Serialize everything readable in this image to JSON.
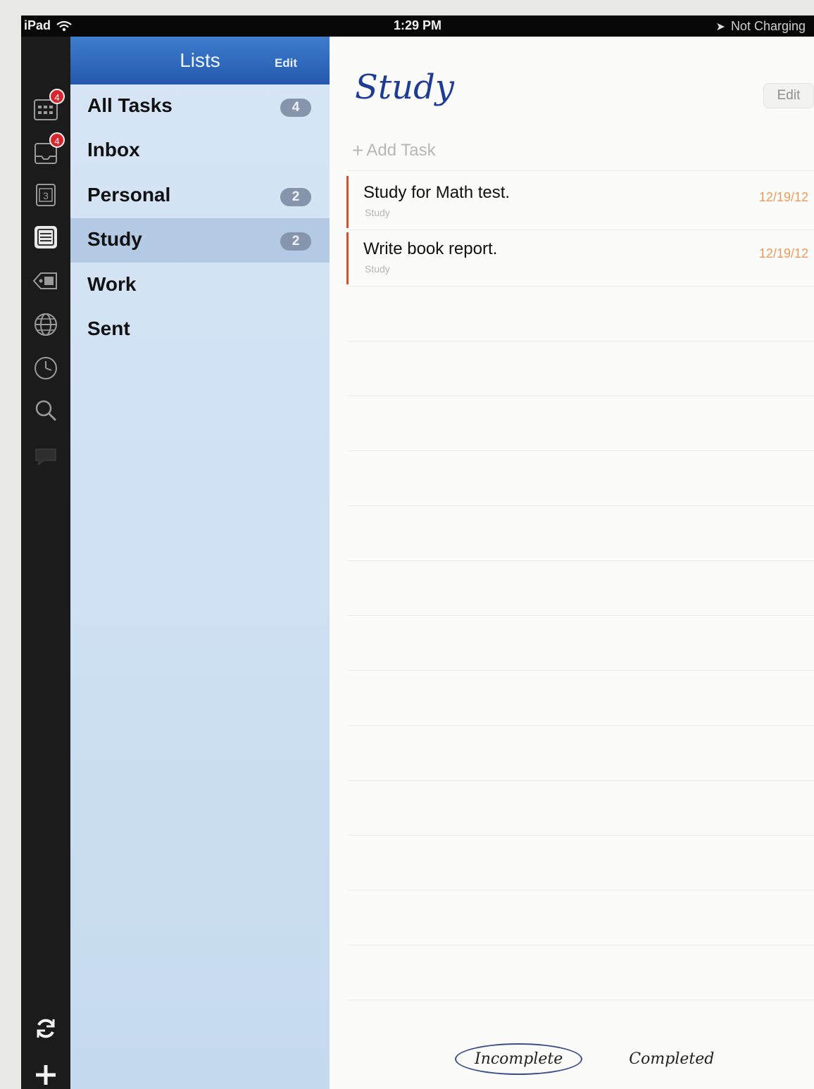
{
  "statusbar": {
    "device": "iPad",
    "time": "1:29 PM",
    "battery_text": "Not Charging"
  },
  "rail": {
    "icons": [
      {
        "name": "calendar-icon",
        "badge": "4"
      },
      {
        "name": "inbox-tray-icon",
        "badge": "4"
      },
      {
        "name": "day-icon",
        "label": "3"
      },
      {
        "name": "lists-icon"
      },
      {
        "name": "tag-icon"
      },
      {
        "name": "globe-icon"
      },
      {
        "name": "clock-icon"
      },
      {
        "name": "search-icon"
      },
      {
        "name": "chat-icon"
      }
    ],
    "bottom_icons": [
      "sync-icon",
      "add-icon"
    ]
  },
  "lists": {
    "title": "Lists",
    "edit_label": "Edit",
    "items": [
      {
        "label": "All Tasks",
        "count": "4"
      },
      {
        "label": "Inbox",
        "count": ""
      },
      {
        "label": "Personal",
        "count": "2"
      },
      {
        "label": "Study",
        "count": "2",
        "selected": true
      },
      {
        "label": "Work",
        "count": ""
      },
      {
        "label": "Sent",
        "count": ""
      }
    ]
  },
  "main": {
    "title": "Study",
    "edit_label": "Edit",
    "add_task_label": "Add Task",
    "tasks": [
      {
        "title": "Study for Math test.",
        "list": "Study",
        "date": "12/19/12"
      },
      {
        "title": "Write book report.",
        "list": "Study",
        "date": "12/19/12"
      }
    ],
    "filters": [
      {
        "label": "Incomplete",
        "active": true
      },
      {
        "label": "Completed",
        "active": false
      }
    ]
  },
  "colors": {
    "header_blue": "#2a63b8",
    "list_bg": "#cfe0f3",
    "task_accent": "#e24a2a",
    "date_orange": "#eb9a5a"
  }
}
